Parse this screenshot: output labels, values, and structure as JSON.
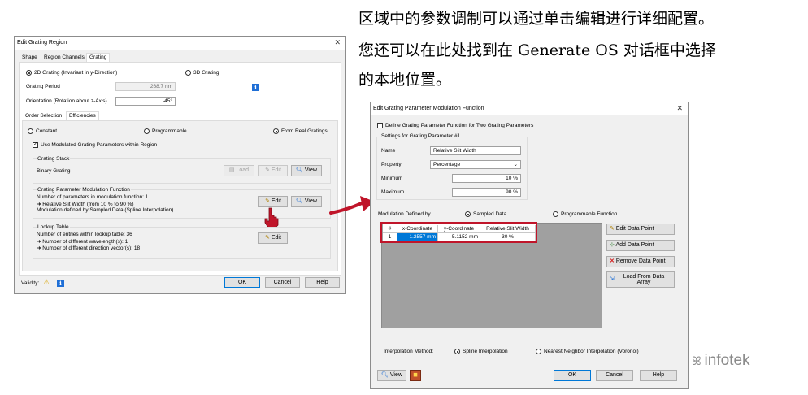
{
  "caption": {
    "line1": "区域中的参数调制可以通过单击编辑进行详细配置。",
    "line2": "您还可以在此处找到在 Generate OS 对话框中选择",
    "line3": "的本地位置。"
  },
  "watermark": "infotek",
  "left_dialog": {
    "title": "Edit Grating Region",
    "tabs": [
      "Shape",
      "Region Channels",
      "Grating"
    ],
    "radio_2d": "2D Grating (Invariant in y-Direction)",
    "radio_3d": "3D Grating",
    "grating_period_label": "Grating Period",
    "grating_period_value": "268.7 nm",
    "orientation_label": "Orientation (Rotation about z-Axis)",
    "orientation_value": "-45°",
    "subtabs": [
      "Order Selection",
      "Efficiencies"
    ],
    "eff_constant": "Constant",
    "eff_programmable": "Programmable",
    "eff_real": "From Real Gratings",
    "use_modulated": "Use Modulated Grating Parameters within Region",
    "stack_title": "Grating Stack",
    "stack_value": "Binary Grating",
    "stack_load": "Load",
    "stack_edit": "Edit",
    "stack_view": "View",
    "mod_title": "Grating Parameter Modulation Function",
    "mod_line1": "Number of parameters in modulation function: 1",
    "mod_line2": "➜ Relative Slit Width (from 10 % to 90 %)",
    "mod_line3": "Modulation defined by Sampled Data (Spline Interpolation)",
    "mod_edit": "Edit",
    "mod_view": "View",
    "lookup_title": "Lookup Table",
    "lookup_line1": "Number of entries within lookup table: 36",
    "lookup_line2": "➜ Number of different wavelength(s): 1",
    "lookup_line3": "➜ Number of different direction vector(s): 18",
    "lookup_edit": "Edit",
    "validity": "Validity:",
    "ok": "OK",
    "cancel": "Cancel",
    "help": "Help"
  },
  "right_dialog": {
    "title": "Edit Grating Parameter Modulation Function",
    "define_two": "Define Grating Parameter Function for Two Grating Parameters",
    "settings_title": "Settings for Grating Parameter #1",
    "name_label": "Name",
    "name_value": "Relative Slit Width",
    "property_label": "Property",
    "property_value": "Percentage",
    "min_label": "Minimum",
    "min_value": "10 %",
    "max_label": "Maximum",
    "max_value": "90 %",
    "mod_defined_by": "Modulation Defined by",
    "sampled": "Sampled Data",
    "programmable": "Programmable Function",
    "table": {
      "headers": [
        "#",
        "x-Coordinate",
        "y-Coordinate",
        "Relative Slit Width"
      ],
      "rows": [
        [
          "1",
          "1.2557 mm",
          "-5.1152 mm",
          "30 %"
        ]
      ]
    },
    "edit_point": "Edit Data Point",
    "add_point": "Add Data Point",
    "remove_point": "Remove Data Point",
    "load_array_1": "Load From Data",
    "load_array_2": "Array",
    "interp_label": "Interpolation Method:",
    "spline": "Spline Interpolation",
    "nearest": "Nearest Neighbor Interpolation (Voronoi)",
    "view": "View",
    "ok": "OK",
    "cancel": "Cancel",
    "help": "Help"
  },
  "colors": {
    "highlight_border": "#c0152a",
    "arrow": "#c0152a",
    "selection_blue": "#0078d7",
    "info_blue": "#1f6fd6"
  }
}
